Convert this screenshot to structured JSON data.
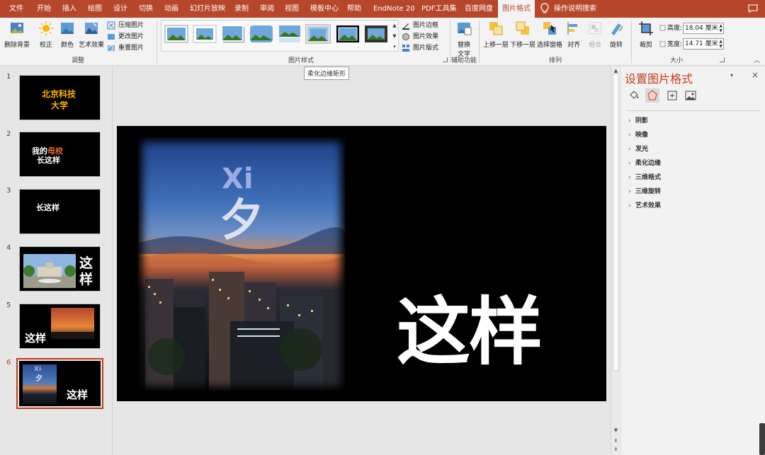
{
  "menu": {
    "tabs": [
      "文件",
      "开始",
      "插入",
      "绘图",
      "设计",
      "切换",
      "动画",
      "幻灯片放映",
      "录制",
      "审阅",
      "视图",
      "模板中心",
      "帮助",
      "EndNote 20",
      "PDF工具集",
      "百度网盘",
      "图片格式"
    ],
    "active_tab": "图片格式",
    "search_label": "操作说明搜索"
  },
  "ribbon": {
    "adjust": {
      "remove_bg": "删除背景",
      "corrections": "校正",
      "color": "颜色",
      "artistic": "艺术效果",
      "compress": "压缩图片",
      "change": "更改图片",
      "reset": "重置图片",
      "group_label": "调整"
    },
    "styles": {
      "border": "图片边框",
      "effects": "图片效果",
      "layout": "图片版式",
      "group_label": "图片样式"
    },
    "accessibility": {
      "alt_text_line1": "替换",
      "alt_text_line2": "文字",
      "group_label": "辅助功能"
    },
    "arrange": {
      "bring_forward": "上移一层",
      "send_backward": "下移一层",
      "selection_pane": "选择窗格",
      "align": "对齐",
      "group": "组合",
      "rotate": "旋转",
      "group_label": "排列"
    },
    "size": {
      "crop": "裁剪",
      "height_label": "高度:",
      "height_value": "18.04 厘米",
      "width_label": "宽度:",
      "width_value": "14.71 厘米",
      "group_label": "大小"
    }
  },
  "tooltip": "柔化边缘矩形",
  "slides": [
    {
      "number": "1",
      "line1": "北京科技",
      "line2": "大学"
    },
    {
      "number": "2",
      "prefix": "我的",
      "highlight": "母校",
      "line2": "长这样"
    },
    {
      "number": "3",
      "line1": "长这样"
    },
    {
      "number": "4",
      "char1": "这",
      "char2": "样"
    },
    {
      "number": "5",
      "text": "这样"
    },
    {
      "number": "6",
      "text": "这样",
      "overlay1": "Xi",
      "overlay2": "夕"
    }
  ],
  "active_slide": "6",
  "main_slide": {
    "big_text": "这样",
    "overlay_latin": "Xi",
    "overlay_char": "夕"
  },
  "format_pane": {
    "title": "设置图片格式",
    "sections": [
      "阴影",
      "映像",
      "发光",
      "柔化边缘",
      "三维格式",
      "三维旋转",
      "艺术效果"
    ]
  },
  "colors": {
    "accent": "#b7472a",
    "active_red": "#c43e1c",
    "title_gold": "#f7b500"
  }
}
